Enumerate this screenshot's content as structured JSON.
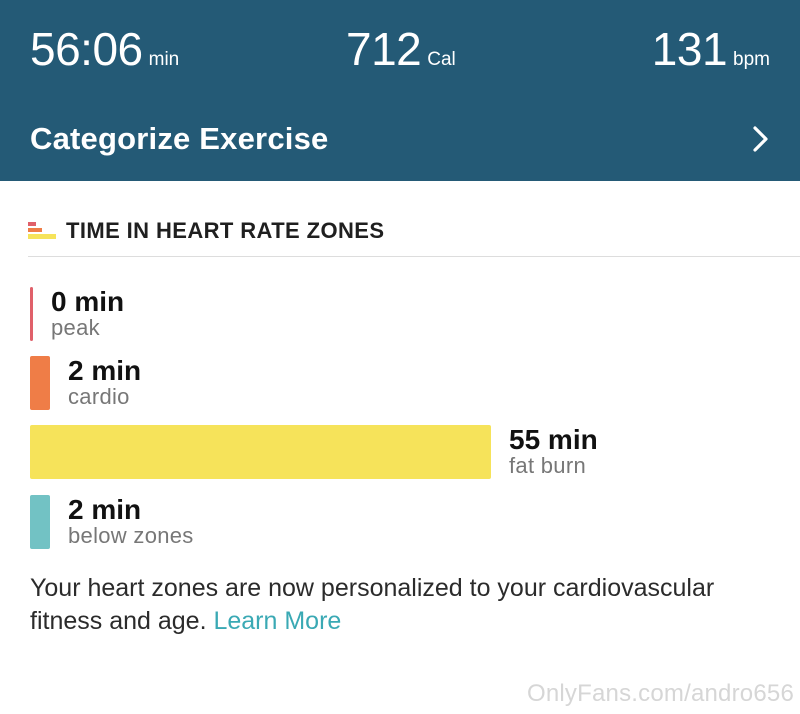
{
  "stats": {
    "duration": {
      "value": "56:06",
      "unit": "min"
    },
    "calories": {
      "value": "712",
      "unit": "Cal"
    },
    "heart_rate": {
      "value": "131",
      "unit": "bpm"
    }
  },
  "categorize": {
    "label": "Categorize Exercise"
  },
  "section": {
    "title": "TIME IN HEART RATE ZONES"
  },
  "zones": [
    {
      "value": "0 min",
      "label": "peak",
      "minutes": 0,
      "color": "#e0606a"
    },
    {
      "value": "2 min",
      "label": "cardio",
      "minutes": 2,
      "color": "#ef7d47"
    },
    {
      "value": "55 min",
      "label": "fat burn",
      "minutes": 55,
      "color": "#f6e35a"
    },
    {
      "value": "2 min",
      "label": "below zones",
      "minutes": 2,
      "color": "#72c2c4"
    }
  ],
  "note": {
    "text": "Your heart zones are now personalized to your cardiovascular fitness and age. ",
    "link": "Learn More"
  },
  "watermark": "OnlyFans.com/andro656",
  "colors": {
    "header_bg": "#245a76",
    "link": "#3aa9b4"
  }
}
